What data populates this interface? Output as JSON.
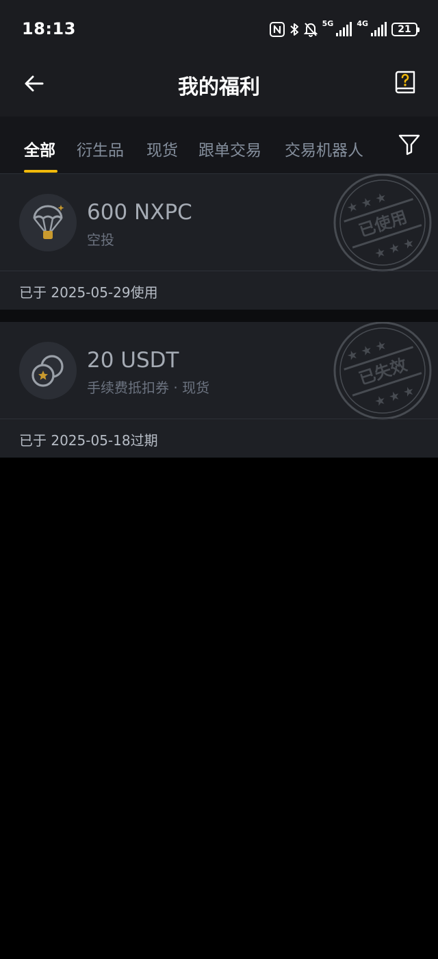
{
  "status_bar": {
    "time": "18:13",
    "net1": "5G",
    "net2": "4G",
    "battery": "21"
  },
  "header": {
    "title": "我的福利"
  },
  "tabs": [
    {
      "label": "全部",
      "active": true
    },
    {
      "label": "衍生品",
      "active": false
    },
    {
      "label": "现货",
      "active": false
    },
    {
      "label": "跟单交易",
      "active": false
    },
    {
      "label": "交易机器人",
      "active": false
    }
  ],
  "rewards": [
    {
      "amount": "600 NXPC",
      "type": "空投",
      "footer": "已于 2025-05-29使用",
      "stamp": "已使用",
      "icon": "parachute-icon"
    },
    {
      "amount": "20 USDT",
      "type": "手续费抵扣券 · 现货",
      "footer": "已于 2025-05-18过期",
      "stamp": "已失效",
      "icon": "coins-icon"
    }
  ],
  "colors": {
    "accent": "#f0b90b",
    "background": "#000000",
    "card": "#1e2025",
    "header": "#1b1c20"
  }
}
